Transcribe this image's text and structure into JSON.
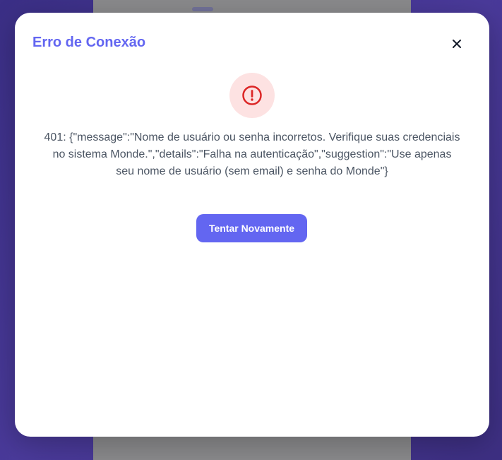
{
  "dialog": {
    "title": "Erro de Conexão",
    "close_icon": "close-icon",
    "alert_icon": "alert-circle-icon",
    "message": "401: {\"message\":\"Nome de usuário ou senha incorretos. Verifique suas credenciais no sistema Monde.\",\"details\":\"Falha na autenticação\",\"suggestion\":\"Use apenas seu nome de usuário (sem email) e senha do Monde\"}",
    "retry_label": "Tentar Novamente"
  },
  "colors": {
    "accent": "#6366f1",
    "error": "#dc2626",
    "error_bg": "#fde2e2",
    "backdrop": "#3b2f86"
  }
}
